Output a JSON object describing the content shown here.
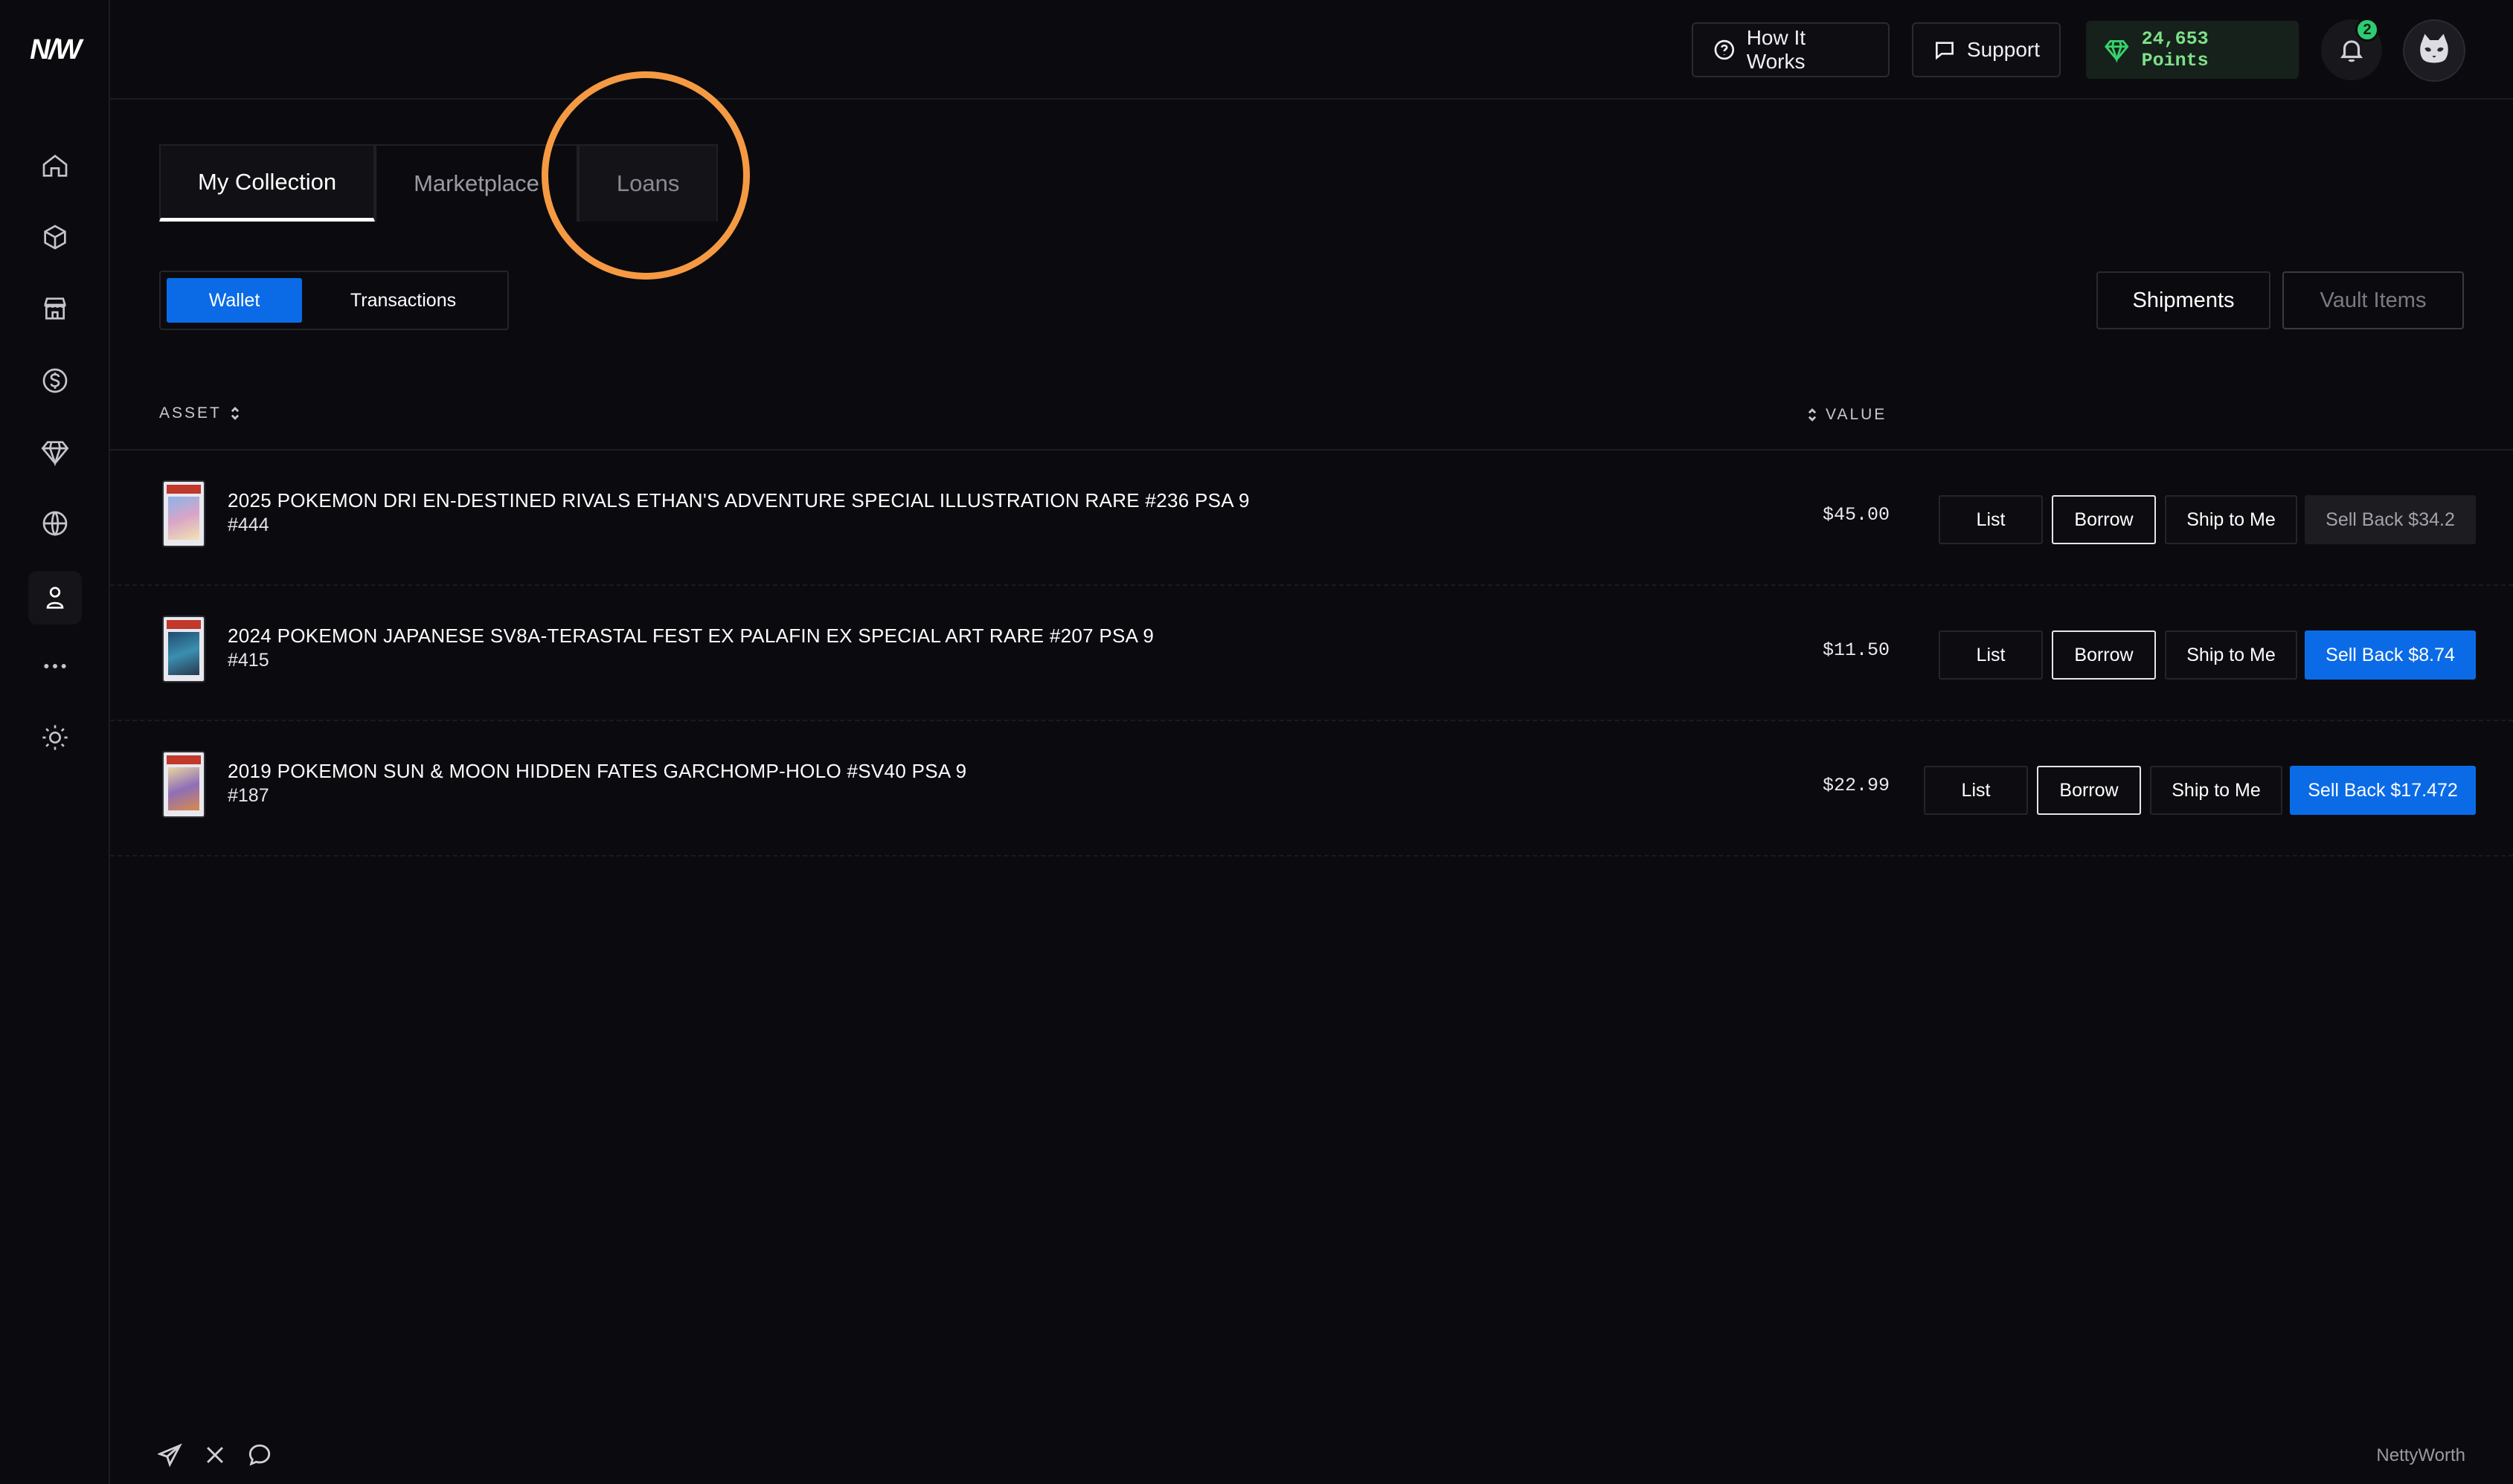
{
  "app": {
    "logo": "N/W",
    "brand": "NettyWorth"
  },
  "header": {
    "how_it_works": "How It Works",
    "support": "Support",
    "points": "24,653 Points",
    "notifications_count": "2"
  },
  "sidebar": {
    "items": [
      {
        "icon": "home-icon"
      },
      {
        "icon": "box-icon"
      },
      {
        "icon": "store-icon"
      },
      {
        "icon": "dollar-icon"
      },
      {
        "icon": "diamond-icon"
      },
      {
        "icon": "globe-icon"
      },
      {
        "icon": "user-icon",
        "active": true
      },
      {
        "icon": "more-icon"
      },
      {
        "icon": "sun-icon"
      }
    ]
  },
  "tabs": [
    "My Collection",
    "Marketplace",
    "Loans"
  ],
  "subtabs": [
    "Wallet",
    "Transactions"
  ],
  "buttons": {
    "shipments": "Shipments",
    "vault_items": "Vault Items"
  },
  "table": {
    "headers": {
      "asset": "ASSET",
      "value": "VALUE"
    },
    "rows": [
      {
        "name": "2025 POKEMON DRI EN-DESTINED RIVALS ETHAN'S ADVENTURE SPECIAL ILLUSTRATION RARE #236 PSA 9",
        "id": "#444",
        "value": "$45.00",
        "list": "List",
        "borrow": "Borrow",
        "ship": "Ship to Me",
        "sell": "Sell Back $34.2",
        "sell_enabled": false
      },
      {
        "name": "2024 POKEMON JAPANESE SV8A-TERASTAL FEST EX PALAFIN EX SPECIAL ART RARE #207 PSA 9",
        "id": "#415",
        "value": "$11.50",
        "list": "List",
        "borrow": "Borrow",
        "ship": "Ship to Me",
        "sell": "Sell Back $8.74",
        "sell_enabled": true
      },
      {
        "name": "2019 POKEMON SUN & MOON HIDDEN FATES GARCHOMP-HOLO #SV40 PSA 9",
        "id": "#187",
        "value": "$22.99",
        "list": "List",
        "borrow": "Borrow",
        "ship": "Ship to Me",
        "sell": "Sell Back $17.472",
        "sell_enabled": true
      }
    ]
  },
  "colors": {
    "accent": "#0b6be6",
    "points_green": "#35d36b",
    "highlight": "#f59a43"
  }
}
